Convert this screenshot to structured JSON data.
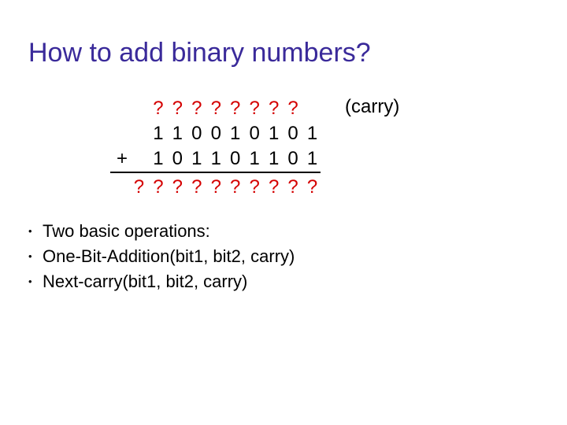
{
  "title": "How to add binary numbers?",
  "carry_label": "(carry)",
  "addition": {
    "carry_row": [
      "",
      "?",
      "?",
      "?",
      "?",
      "?",
      "?",
      "?",
      "?",
      ""
    ],
    "first_row": [
      "",
      "1",
      "1",
      "0",
      "0",
      "1",
      "0",
      "1",
      "0",
      "1"
    ],
    "second_row": [
      "",
      "1",
      "0",
      "1",
      "1",
      "0",
      "1",
      "1",
      "0",
      "1"
    ],
    "result_row": [
      "?",
      "?",
      "?",
      "?",
      "?",
      "?",
      "?",
      "?",
      "?",
      "?"
    ],
    "plus_sign": "+"
  },
  "bullets": [
    "Two basic operations:",
    "One-Bit-Addition(bit1, bit2, carry)",
    "Next-carry(bit1, bit2, carry)"
  ]
}
